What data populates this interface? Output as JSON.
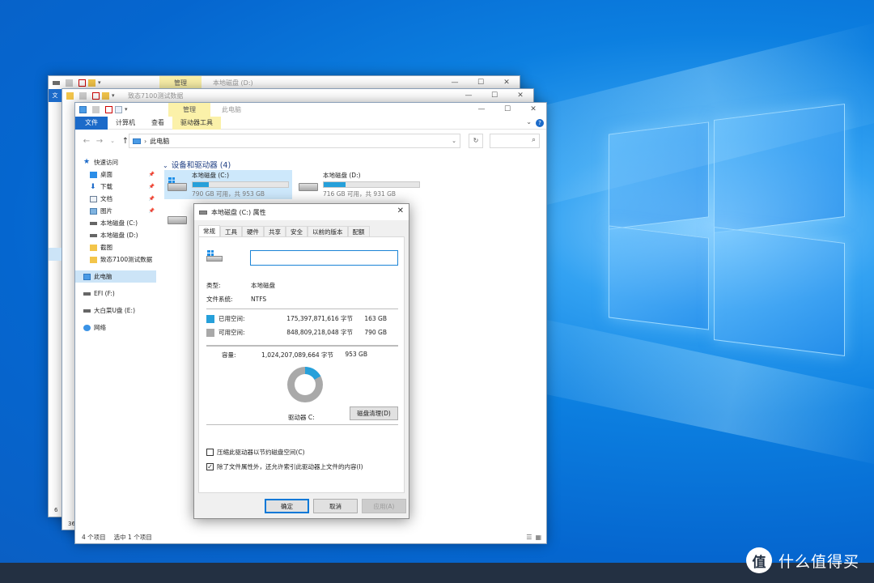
{
  "colors": {
    "desktop_blue": "#0566cf",
    "used_space": "#26a0da",
    "free_space": "#a9a9a9",
    "file_tab": "#1b6ac9",
    "manage_tab": "#fbf1a9",
    "taskbar": "#233042"
  },
  "back_window_2": {
    "manage_tab": "管理",
    "title": "本地磁盘 (D:)"
  },
  "back_window_1": {
    "title": "致态7100测试数据",
    "side_letter": "文",
    "status_digit": "6"
  },
  "back_window_3_extra": {
    "status_digit": "36"
  },
  "front_window": {
    "manage_tab": "管理",
    "title": "此电脑",
    "ribbon_tabs": [
      "文件",
      "计算机",
      "查看",
      "驱动器工具"
    ],
    "address": "此电脑",
    "nav": {
      "quick_access": "快速访问",
      "pinned": [
        {
          "label": "桌面",
          "icon": "desktop-icon"
        },
        {
          "label": "下载",
          "icon": "download-icon"
        },
        {
          "label": "文档",
          "icon": "document-icon"
        },
        {
          "label": "图片",
          "icon": "picture-icon"
        }
      ],
      "recent": [
        {
          "label": "本地磁盘 (C:)",
          "icon": "drive-icon"
        },
        {
          "label": "本地磁盘 (D:)",
          "icon": "drive-icon"
        },
        {
          "label": "截图",
          "icon": "folder-icon"
        },
        {
          "label": "致态7100测试数据",
          "icon": "folder-icon"
        }
      ],
      "this_pc": "此电脑",
      "efi": "EFI (F:)",
      "usb": "大白菜U盘 (E:)",
      "network": "网络"
    },
    "section_title": "设备和驱动器 (4)",
    "drives": [
      {
        "name": "本地磁盘 (C:)",
        "free": "790 GB 可用，共 953 GB",
        "used_fraction": 0.17
      },
      {
        "name": "本地磁盘 (D:)",
        "free": "716 GB 可用，共 931 GB",
        "used_fraction": 0.23
      }
    ],
    "status": {
      "items": "4 个项目",
      "selected": "选中 1 个项目"
    }
  },
  "dialog": {
    "title": "本地磁盘 (C:) 属性",
    "tabs": [
      "常规",
      "工具",
      "硬件",
      "共享",
      "安全",
      "以前的版本",
      "配额"
    ],
    "label_value": "",
    "type_label": "类型:",
    "type_value": "本地磁盘",
    "fs_label": "文件系统:",
    "fs_value": "NTFS",
    "used": {
      "label": "已用空间:",
      "bytes": "175,397,871,616 字节",
      "gb": "163 GB"
    },
    "free": {
      "label": "可用空间:",
      "bytes": "848,809,218,048 字节",
      "gb": "790 GB"
    },
    "capacity": {
      "label": "容量:",
      "bytes": "1,024,207,089,664 字节",
      "gb": "953 GB"
    },
    "used_fraction": 0.171,
    "drive_letter": "驱动器 C:",
    "cleanup_button": "磁盘清理(D)",
    "compress_label": "压缩此驱动器以节约磁盘空间(C)",
    "index_label": "除了文件属性外，还允许索引此驱动器上文件的内容(I)",
    "ok": "确定",
    "cancel": "取消",
    "apply": "应用(A)"
  },
  "watermark": {
    "glyph": "值",
    "text": "什么值得买"
  }
}
